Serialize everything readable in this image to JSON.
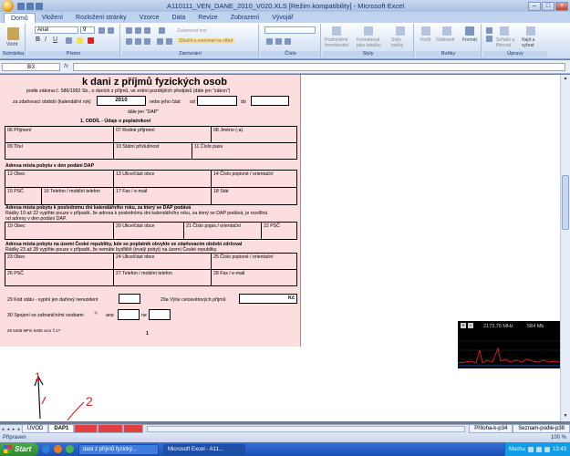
{
  "window": {
    "title": "A110111_VEN_DANE_2010_V020.XLS  [Režim kompatibility]  -  Microsoft Excel"
  },
  "tabs": [
    "Domů",
    "Vložení",
    "Rozložení stránky",
    "Vzorce",
    "Data",
    "Revize",
    "Zobrazení",
    "Vývojář"
  ],
  "ribbon": {
    "groups": [
      "Schránka",
      "Písmo",
      "Zarovnání",
      "Číslo",
      "Styly",
      "Buňky",
      "Úpravy"
    ],
    "paste": "Vložit",
    "font_name": "Arial",
    "font_size": "9",
    "wrap": "Zalamovat text",
    "merge": "Sloučit a zarovnat na střed",
    "cond_format": "Podmíněné formátování",
    "table_format": "Formátovat jako tabulku",
    "cell_styles": "Styly buňky",
    "insert": "Vložit",
    "delete": "Odstranit",
    "format": "Formát",
    "sort": "Seřadit a filtrovat",
    "find": "Najít a vybrat"
  },
  "formula": {
    "name_box": "B3",
    "fx": "fx",
    "value": ""
  },
  "form": {
    "title": "k dani z příjmů fyzických osob",
    "subtitle": "podle zákona č. 586/1992 Sb., o daních z příjmů, ve znění pozdějších předpisů (dále jen \"zákon\")",
    "period_label": "za zdaňovací období (kalendářní rok)",
    "year": "2010",
    "part_label": "nebo jeho část",
    "from": "od",
    "to": "do",
    "dap": "dále jen \"DAP\"",
    "section1": "1. ODDÍL - Údaje o poplatníkovi",
    "f06": "06 Příjmení",
    "f07": "07 Rodné příjmení",
    "f08": "08 Jméno (-a)",
    "f09": "09 Titul",
    "f10": "10 Státní příslušnost",
    "f11": "11 Číslo pasu",
    "addr1_heading": "Adresa místa pobytu v den podání DAP",
    "f12": "12 Obec",
    "f13": "13 Ulice/část obce",
    "f14": "14 Číslo popisné / orientační",
    "f15": "15 PSČ",
    "f16": "16 Telefon / mobilní telefon",
    "f17": "17 Fax / e-mail",
    "f18": "18 Stát",
    "addr2_heading": "Adresa místa pobytu k poslednímu dni kalendářního roku, za který se DAP podává",
    "addr2_note": "Řádky 19 až 22 vyplňte pouze v případě, že adresa k poslednímu dni kalendářního roku, za který se DAP podává, je rozdílná",
    "addr2_note2": "od adresy v den podání DAP.",
    "f19": "19 Obec",
    "f20": "20 Ulice/část obce",
    "f21": "21 Číslo popis./ orientační",
    "f22": "22 PSČ",
    "addr3_heading": "Adresa místa pobytu na území České republiky, kde se poplatník obvykle ve zdaňovacím období zdržoval",
    "addr3_note": "Řádky 23 až 28 vyplňte pouze v případě, že nemáte bydliště (trvalý pobyt) na území České republiky.",
    "f23": "23 Obec",
    "f24": "24 Ulice/část obce",
    "f25": "25 Číslo popisné / orientační",
    "f26": "26 PSČ",
    "f27": "27 Telefon / mobilní telefon",
    "f28": "28 Fax / e-mail",
    "f29": "29 Kód státu - vyplní jen daňový nerezident",
    "f29a": "29a Výše celosvětových příjmů",
    "currency": "Kč",
    "f30": "30 Spojení se zahraničními osobami",
    "sup1": "1)",
    "yes": "ano",
    "no": "ne",
    "footer_code": "25 5405 MFin 5405 vzor č.17",
    "page_no": "1"
  },
  "perf": {
    "cpu_freq": "2173,75 MHz",
    "mem": "584 Mb"
  },
  "sheet_tabs": [
    "ÚVOD",
    "DAP1",
    "",
    "",
    "",
    "Příloha-k-p34",
    "Seznam-podle-p38"
  ],
  "active_sheet_index": 1,
  "status": {
    "text": "Připraven",
    "zoom": "100 %"
  },
  "taskbar": {
    "start": "Start",
    "tasks": [
      "dani z příjmů fyzický...",
      "Microsoft Excel - A11..."
    ],
    "lang": "Mochu",
    "time": "13:43"
  },
  "annotations": [
    "1",
    "2"
  ],
  "colors": {
    "form_bg": "#fcdede",
    "annotation": "#e02020",
    "ribbon": "#dfe9f7",
    "taskbar": "#245dc6"
  }
}
